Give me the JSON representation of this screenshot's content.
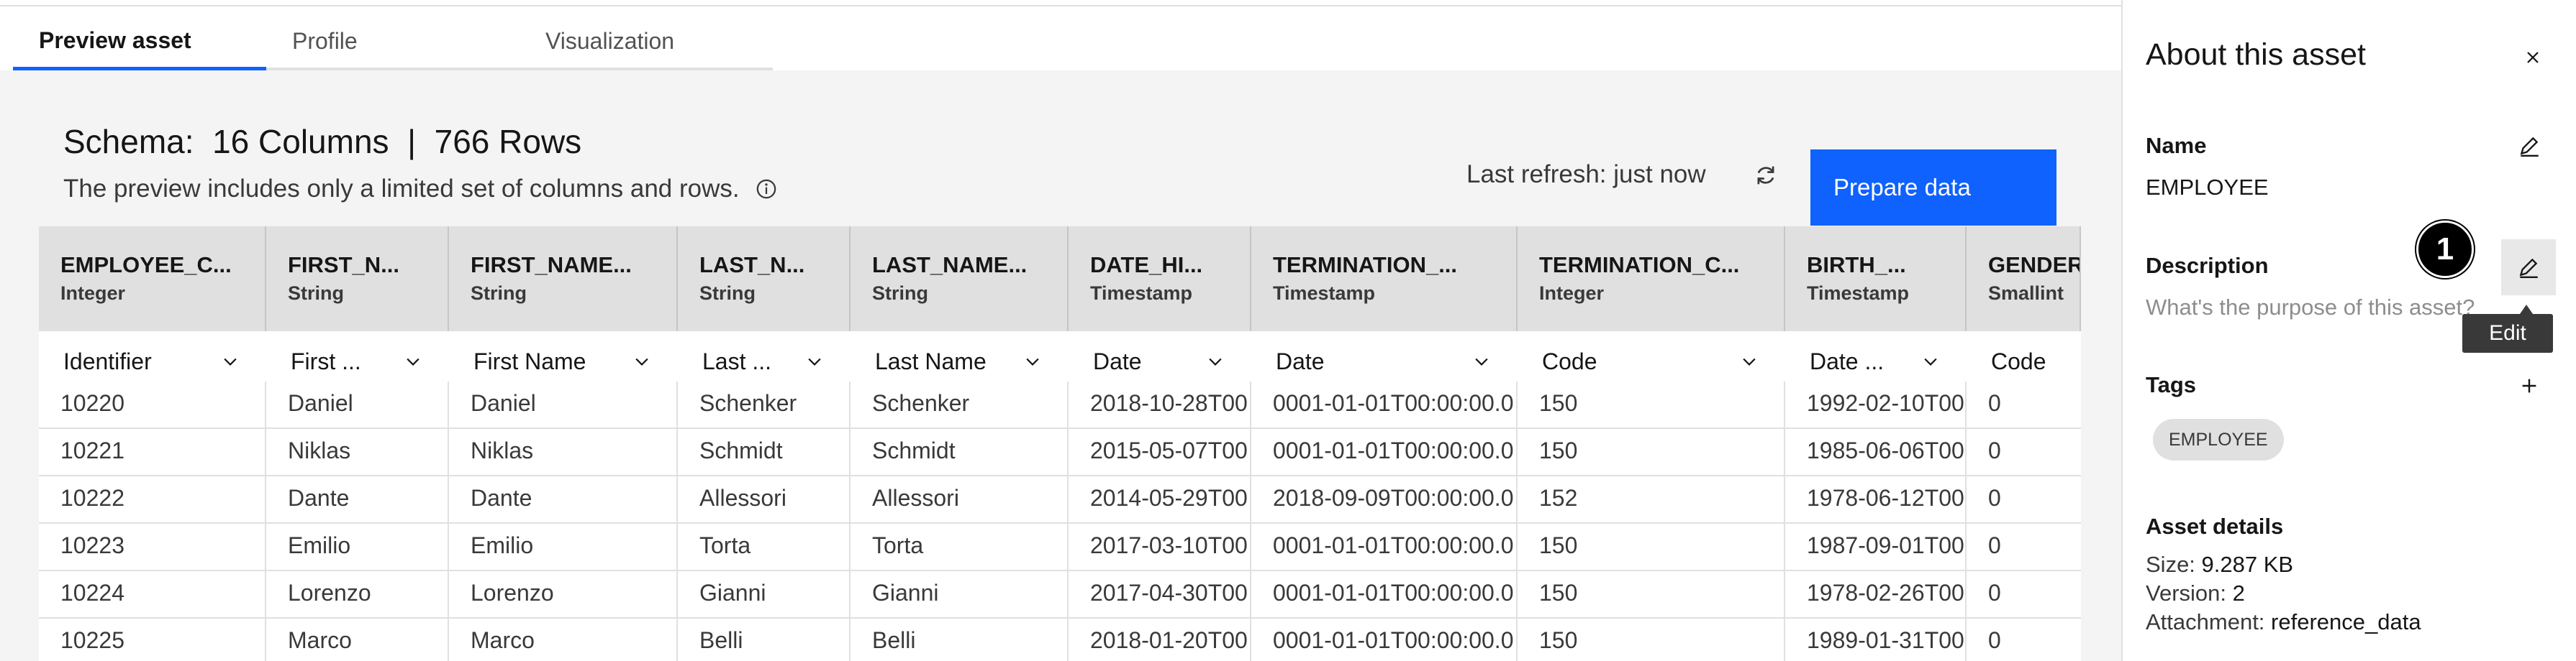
{
  "tabs": [
    {
      "label": "Preview asset",
      "active": true
    },
    {
      "label": "Profile",
      "active": false
    },
    {
      "label": "Visualization",
      "active": false
    }
  ],
  "schema": {
    "title": "Schema:  16 Columns  |  766 Rows",
    "subtitle": "The preview includes only a limited set of columns and rows."
  },
  "toolbar": {
    "last_refresh": "Last refresh: just now",
    "prepare_label": "Prepare data"
  },
  "table": {
    "columns": [
      {
        "name": "EMPLOYEE_C...",
        "type": "Integer",
        "class": "Identifier"
      },
      {
        "name": "FIRST_N...",
        "type": "String",
        "class": "First ..."
      },
      {
        "name": "FIRST_NAME...",
        "type": "String",
        "class": "First Name"
      },
      {
        "name": "LAST_N...",
        "type": "String",
        "class": "Last ..."
      },
      {
        "name": "LAST_NAME...",
        "type": "String",
        "class": "Last Name"
      },
      {
        "name": "DATE_HI...",
        "type": "Timestamp",
        "class": "Date"
      },
      {
        "name": "TERMINATION_...",
        "type": "Timestamp",
        "class": "Date"
      },
      {
        "name": "TERMINATION_C...",
        "type": "Integer",
        "class": "Code"
      },
      {
        "name": "BIRTH_...",
        "type": "Timestamp",
        "class": "Date ..."
      },
      {
        "name": "GENDER",
        "type": "Smallint",
        "class": "Code"
      }
    ],
    "rows": [
      [
        "10220",
        "Daniel",
        "Daniel",
        "Schenker",
        "Schenker",
        "2018-10-28T00",
        "0001-01-01T00:00:00.0",
        "150",
        "1992-02-10T00",
        "0"
      ],
      [
        "10221",
        "Niklas",
        "Niklas",
        "Schmidt",
        "Schmidt",
        "2015-05-07T00",
        "0001-01-01T00:00:00.0",
        "150",
        "1985-06-06T00",
        "0"
      ],
      [
        "10222",
        "Dante",
        "Dante",
        "Allessori",
        "Allessori",
        "2014-05-29T00",
        "2018-09-09T00:00:00.0",
        "152",
        "1978-06-12T00",
        "0"
      ],
      [
        "10223",
        "Emilio",
        "Emilio",
        "Torta",
        "Torta",
        "2017-03-10T00",
        "0001-01-01T00:00:00.0",
        "150",
        "1987-09-01T00",
        "0"
      ],
      [
        "10224",
        "Lorenzo",
        "Lorenzo",
        "Gianni",
        "Gianni",
        "2017-04-30T00",
        "0001-01-01T00:00:00.0",
        "150",
        "1978-02-26T00",
        "0"
      ],
      [
        "10225",
        "Marco",
        "Marco",
        "Belli",
        "Belli",
        "2018-01-20T00",
        "0001-01-01T00:00:00.0",
        "150",
        "1989-01-31T00",
        "0"
      ]
    ]
  },
  "side_panel": {
    "title": "About this asset",
    "name_label": "Name",
    "name_value": "EMPLOYEE",
    "description_label": "Description",
    "description_placeholder": "What's the purpose of this asset?",
    "edit_tooltip": "Edit",
    "step_badge": "1",
    "tags_label": "Tags",
    "tags": [
      "EMPLOYEE"
    ],
    "details_label": "Asset details",
    "size_label": "Size:",
    "size_value": "9.287 KB",
    "version_label": "Version:",
    "version_value": "2",
    "attachment_label": "Attachment:",
    "attachment_value": "reference_data"
  },
  "colors": {
    "accent": "#0f62fe",
    "header_bg": "#e0e0e0",
    "panel_bg": "#f4f4f4"
  },
  "icons": [
    "info-icon",
    "refresh-icon",
    "chevron-down-icon",
    "close-icon",
    "edit-icon",
    "plus-icon"
  ]
}
